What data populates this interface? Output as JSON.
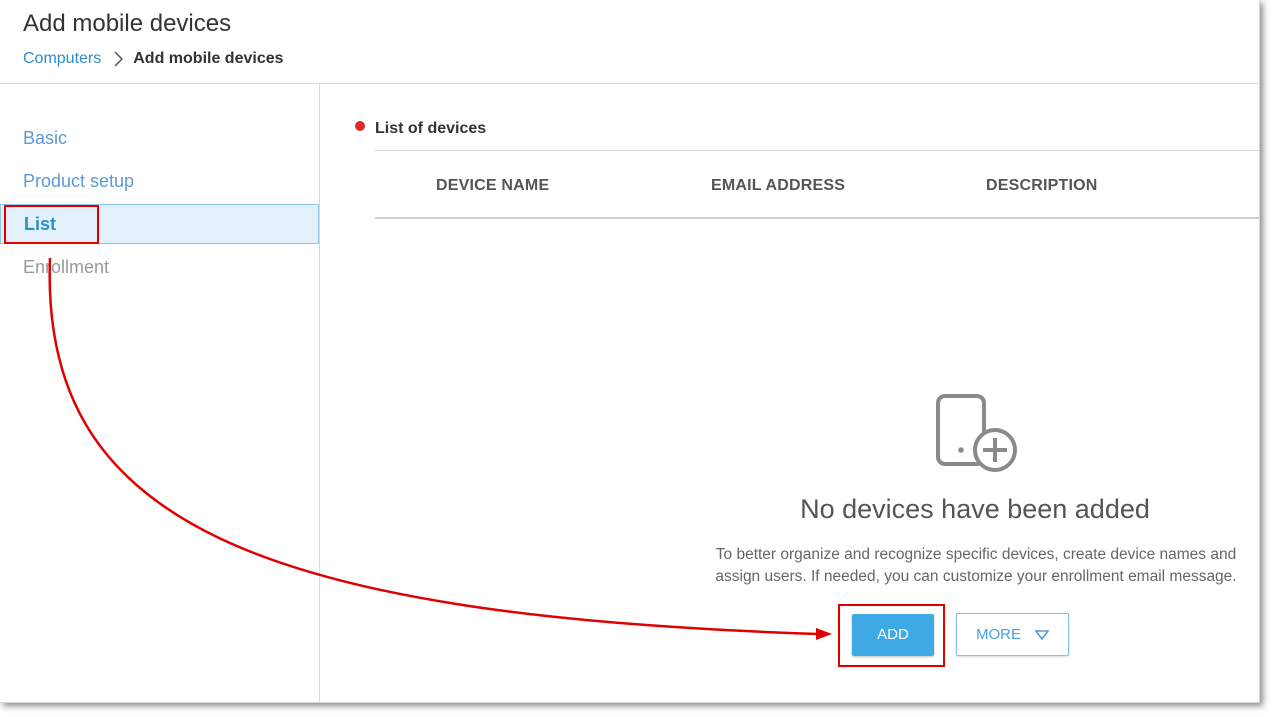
{
  "header": {
    "title": "Add mobile devices",
    "breadcrumb": {
      "link": "Computers",
      "current": "Add mobile devices"
    }
  },
  "sidebar": {
    "items": [
      {
        "label": "Basic",
        "state": "link"
      },
      {
        "label": "Product setup",
        "state": "link"
      },
      {
        "label": "List",
        "state": "active"
      },
      {
        "label": "Enrollment",
        "state": "disabled"
      }
    ]
  },
  "main": {
    "section_title": "List of devices",
    "table": {
      "columns": [
        "DEVICE NAME",
        "EMAIL ADDRESS",
        "DESCRIPTION"
      ],
      "rows": []
    },
    "empty_state": {
      "icon": "mobile-add-icon",
      "title": "No devices have been added",
      "description": "To better organize and recognize specific devices, create device names and assign users. If needed, you can customize your enrollment email message."
    },
    "buttons": {
      "add": "ADD",
      "more": "MORE"
    }
  },
  "colors": {
    "accent": "#3fa9e5",
    "link": "#2e8ec6",
    "required_dot": "#e02a2a",
    "annotation": "#e00000",
    "active_bg": "#e1f0fb"
  }
}
